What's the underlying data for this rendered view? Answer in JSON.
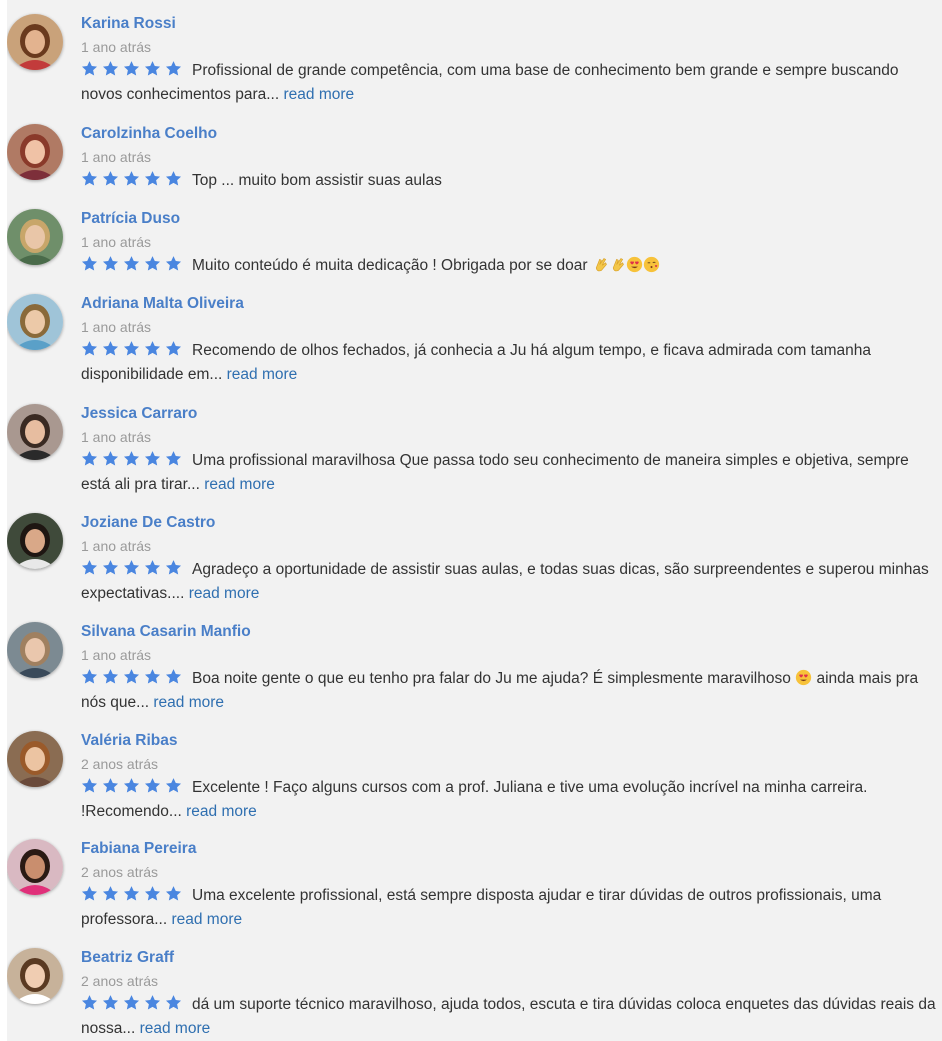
{
  "colors": {
    "accent": "#4a7fc8",
    "link": "#2f6fb0",
    "star": "#4a86e0",
    "text": "#333333",
    "muted": "#9a9a9a"
  },
  "reviews": [
    {
      "name": "Karina Rossi",
      "time": "1 ano atrás",
      "rating": 5,
      "text": "Profissional de grande competência, com uma base de conhecimento bem grande e sempre buscando novos conhecimentos para...",
      "read_more": "read more"
    },
    {
      "name": "Carolzinha Coelho",
      "time": "1 ano atrás",
      "rating": 5,
      "text": "Top ... muito bom assistir suas aulas"
    },
    {
      "name": "Patrícia Duso",
      "time": "1 ano atrás",
      "rating": 5,
      "text": "Muito conteúdo é muita dedicação ! Obrigada por se doar",
      "emojis": [
        "clapping-hands",
        "clapping-hands",
        "heart-eyes",
        "face-blowing-kiss"
      ]
    },
    {
      "name": "Adriana Malta Oliveira",
      "time": "1 ano atrás",
      "rating": 5,
      "text": "Recomendo de olhos fechados, já conhecia a Ju há algum tempo, e ficava admirada com tamanha disponibilidade em...",
      "read_more": "read more"
    },
    {
      "name": "Jessica Carraro",
      "time": "1 ano atrás",
      "rating": 5,
      "text": "Uma profissional maravilhosa Que passa todo seu conhecimento de maneira simples e objetiva, sempre está ali pra tirar...",
      "read_more": "read more"
    },
    {
      "name": "Joziane De Castro",
      "time": "1 ano atrás",
      "rating": 5,
      "text": "Agradeço a oportunidade de assistir suas aulas, e todas suas dicas, são surpreendentes e superou minhas expectativas....",
      "read_more": "read more"
    },
    {
      "name": "Silvana Casarin Manfio",
      "time": "1 ano atrás",
      "rating": 5,
      "text": "Boa noite gente o que eu tenho pra falar do Ju me ajuda? É simplesmente maravilhoso",
      "emojis": [
        "heart-eyes"
      ],
      "text_after": "ainda mais pra nós que...",
      "read_more": "read more"
    },
    {
      "name": "Valéria Ribas",
      "time": "2 anos atrás",
      "rating": 5,
      "text": "Excelente ! Faço alguns cursos com a prof. Juliana e tive uma evolução incrível na minha carreira. !Recomendo...",
      "read_more": "read more"
    },
    {
      "name": "Fabiana Pereira",
      "time": "2 anos atrás",
      "rating": 5,
      "text": "Uma excelente profissional, está sempre disposta ajudar e tirar dúvidas de outros profissionais, uma professora...",
      "read_more": "read more"
    },
    {
      "name": "Beatriz Graff",
      "time": "2 anos atrás",
      "rating": 5,
      "text": "dá um suporte técnico maravilhoso, ajuda todos, escuta e tira dúvidas coloca enquetes das dúvidas reais da nossa...",
      "read_more": "read more"
    }
  ]
}
